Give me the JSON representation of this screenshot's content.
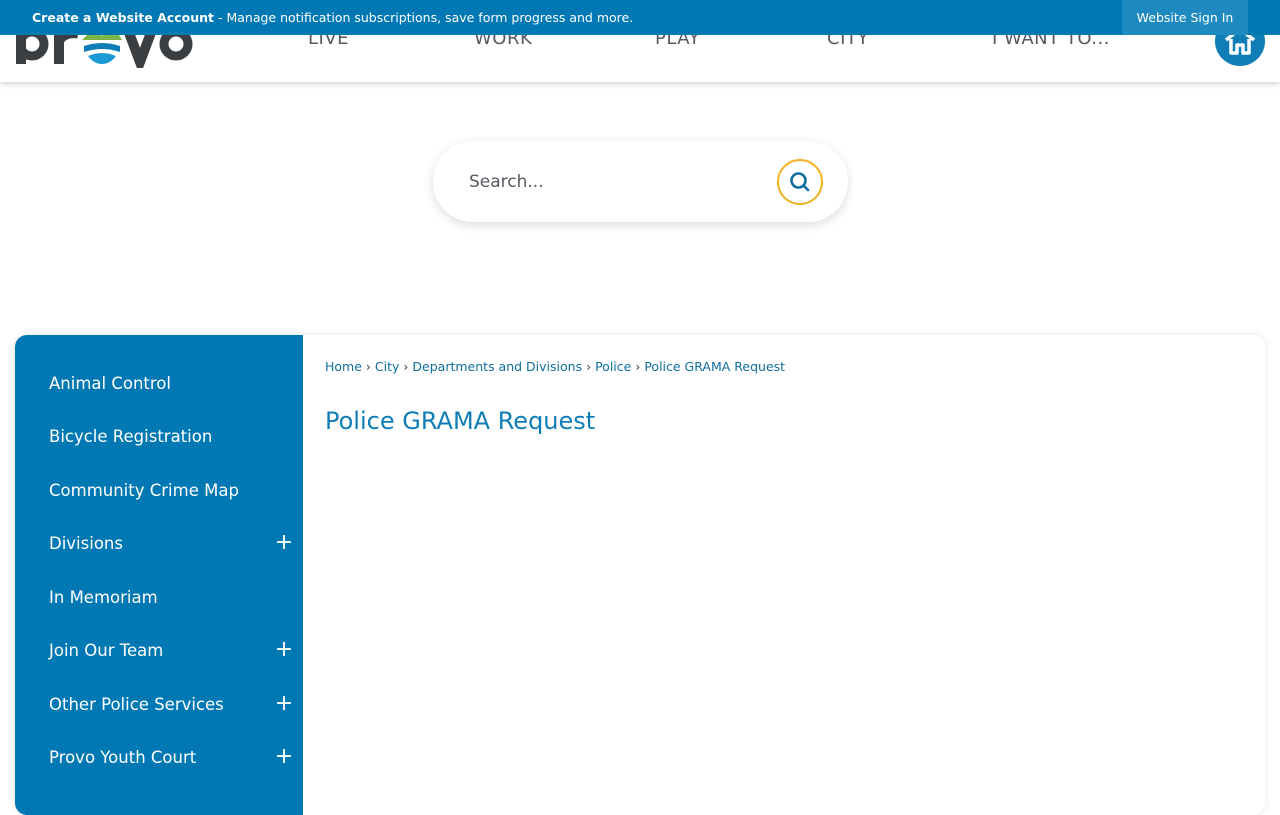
{
  "account_bar": {
    "create_account": "Create a Website Account",
    "description": " - Manage notification subscriptions, save form progress and more.",
    "sign_in": "Website Sign In"
  },
  "header": {
    "logo_text": "provo",
    "nav": [
      "LIVE",
      "WORK",
      "PLAY",
      "CITY",
      "I WANT TO..."
    ]
  },
  "search": {
    "placeholder": "Search..."
  },
  "sidebar": {
    "items": [
      {
        "label": "Animal Control",
        "expandable": false
      },
      {
        "label": "Bicycle Registration",
        "expandable": false
      },
      {
        "label": "Community Crime Map",
        "expandable": false
      },
      {
        "label": "Divisions",
        "expandable": true
      },
      {
        "label": "In Memoriam",
        "expandable": false
      },
      {
        "label": "Join Our Team",
        "expandable": true
      },
      {
        "label": "Other Police Services",
        "expandable": true
      },
      {
        "label": "Provo Youth Court",
        "expandable": true
      }
    ],
    "expand_symbol": "+"
  },
  "breadcrumb": {
    "items": [
      "Home",
      "City",
      "Departments and Divisions",
      "Police"
    ],
    "current": "Police GRAMA Request",
    "separator": "›"
  },
  "page": {
    "title": "Police GRAMA Request"
  },
  "colors": {
    "brand_blue": "#0078b4",
    "accent_yellow": "#f0b323",
    "logo_green": "#7ab648",
    "logo_dark": "#3c3f42"
  },
  "icons": {
    "home": "home-icon",
    "search": "search-icon",
    "expand": "plus-icon"
  }
}
